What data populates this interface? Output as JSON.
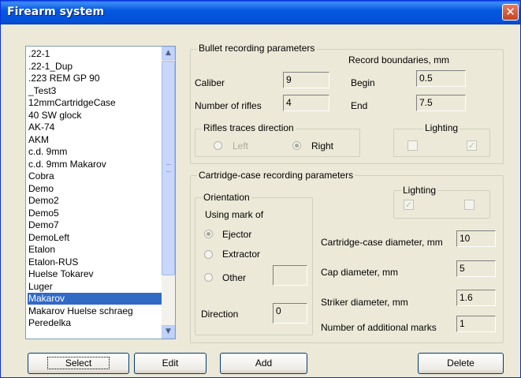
{
  "window": {
    "title": "Firearm system",
    "close": "✕"
  },
  "list": {
    "items": [
      ".22-1",
      ".22-1_Dup",
      ".223 REM GP 90",
      "_Test3",
      "12mmCartridgeCase",
      "40 SW glock",
      "AK-74",
      "AKM",
      "c.d. 9mm",
      "c.d. 9mm Makarov",
      "Cobra",
      "Demo",
      "Demo2",
      "Demo5",
      "Demo7",
      "DemoLeft",
      "Etalon",
      "Etalon-RUS",
      "Huelse Tokarev",
      "Luger",
      "Makarov",
      "Makarov Huelse schraeg",
      "Peredelka"
    ],
    "selected": "Makarov",
    "scroll_up": "▲",
    "scroll_down": "▼"
  },
  "bullet": {
    "title": "Bullet recording parameters",
    "caliber_label": "Caliber",
    "caliber": "9",
    "rifles_label": "Number of rifles",
    "rifles": "4",
    "boundaries_label": "Record boundaries, mm",
    "begin_label": "Begin",
    "begin": "0.5",
    "end_label": "End",
    "end": "7.5",
    "direction": {
      "title": "Rifles traces direction",
      "left": "Left",
      "right": "Right",
      "selected": "Right"
    },
    "lighting": {
      "title": "Lighting",
      "first": false,
      "second": true
    }
  },
  "cartridge": {
    "title": "Cartridge-case recording parameters",
    "orientation": {
      "title": "Orientation",
      "using_label": "Using mark of",
      "ejector": "Ejector",
      "extractor": "Extractor",
      "other": "Other",
      "other_value": "",
      "selected": "Ejector",
      "direction_label": "Direction",
      "direction": "0"
    },
    "lighting": {
      "title": "Lighting",
      "first": true,
      "second": false
    },
    "diameter_label": "Cartridge-case diameter, mm",
    "diameter": "10",
    "cap_label": "Cap diameter, mm",
    "cap": "5",
    "striker_label": "Striker diameter, mm",
    "striker": "1.6",
    "marks_label": "Number of additional marks",
    "marks": "1"
  },
  "buttons": {
    "select": "Select",
    "edit": "Edit",
    "add": "Add",
    "delete": "Delete"
  },
  "colors": {
    "titlebar": "#0558e0",
    "selection": "#316ac5",
    "background": "#ece9d8"
  }
}
